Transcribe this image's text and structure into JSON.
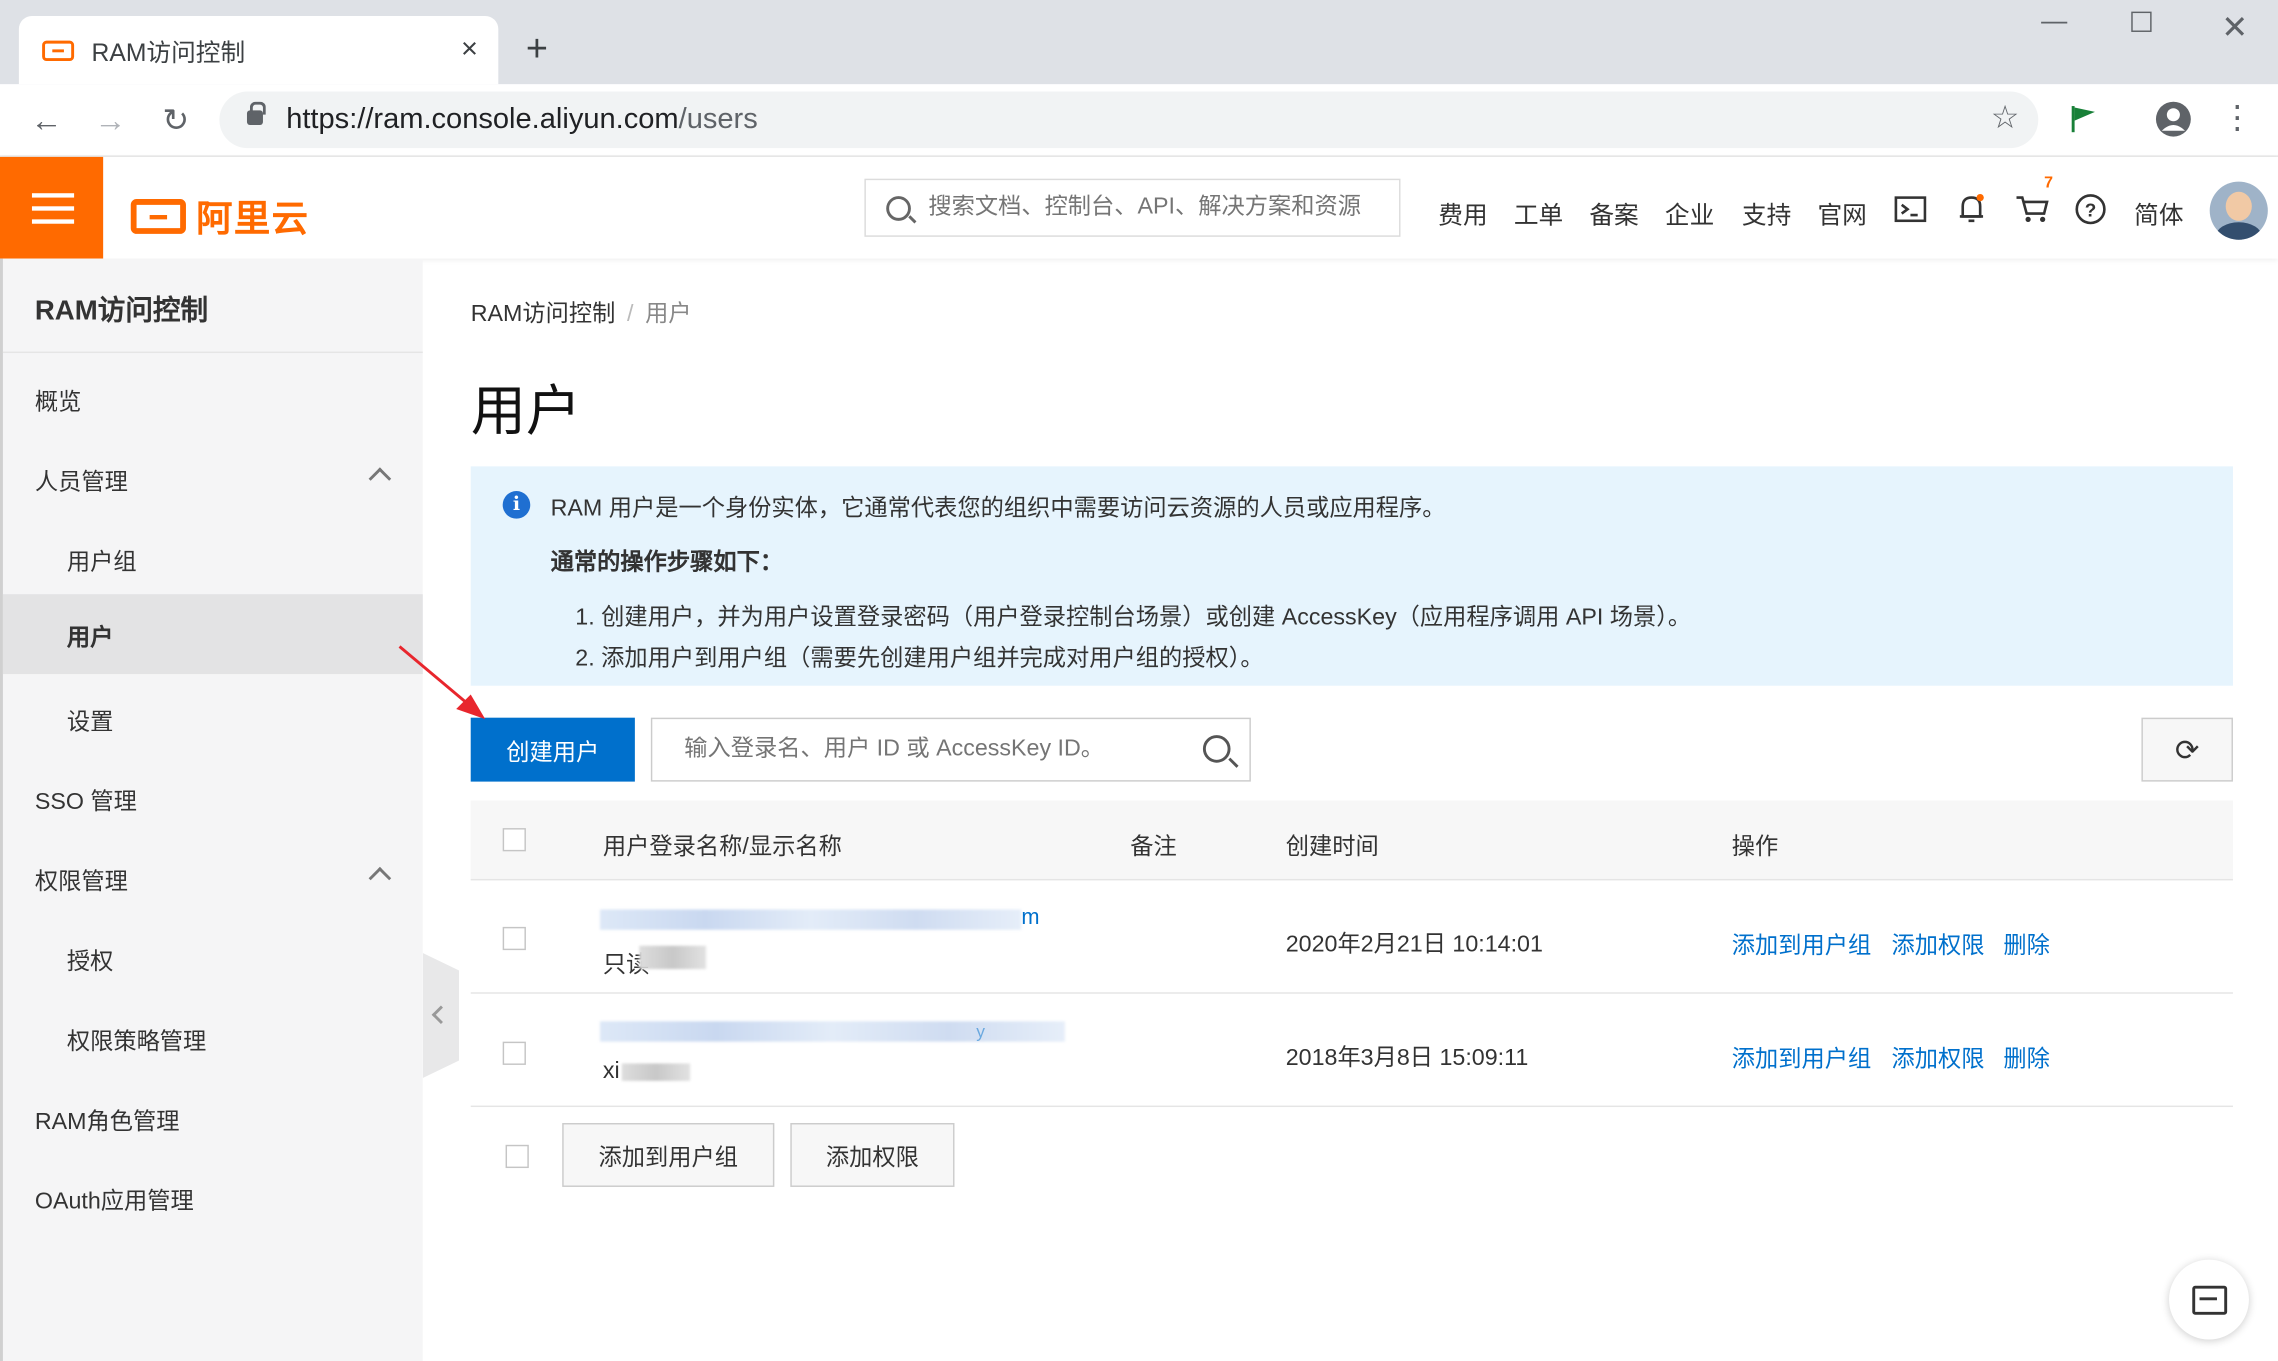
{
  "browser": {
    "tab_title": "RAM访问控制",
    "tab_close": "×",
    "new_tab": "+",
    "url_host": "https://ram.console.aliyun.com",
    "url_path": "/users"
  },
  "header": {
    "logo_text": "阿里云",
    "search_placeholder": "搜索文档、控制台、API、解决方案和资源",
    "links": [
      "费用",
      "工单",
      "备案",
      "企业",
      "支持",
      "官网"
    ],
    "cart_badge": "7",
    "lang": "简体",
    "brand_color": "#ff6a00"
  },
  "sidebar": {
    "title": "RAM访问控制",
    "items": [
      {
        "label": "概览"
      },
      {
        "label": "人员管理"
      },
      {
        "label": "用户组"
      },
      {
        "label": "用户"
      },
      {
        "label": "设置"
      },
      {
        "label": "SSO 管理"
      },
      {
        "label": "权限管理"
      },
      {
        "label": "授权"
      },
      {
        "label": "权限策略管理"
      },
      {
        "label": "RAM角色管理"
      },
      {
        "label": "OAuth应用管理"
      }
    ]
  },
  "breadcrumb": {
    "root": "RAM访问控制",
    "sep": "/",
    "current": "用户"
  },
  "page_title": "用户",
  "notice": {
    "line1": "RAM 用户是一个身份实体，它通常代表您的组织中需要访问云资源的人员或应用程序。",
    "heading": "通常的操作步骤如下：",
    "step1": "1. 创建用户，并为用户设置登录密码（用户登录控制台场景）或创建 AccessKey（应用程序调用 API 场景）。",
    "step2": "2. 添加用户到用户组（需要先创建用户组并完成对用户组的授权）。"
  },
  "toolbar": {
    "create_label": "创建用户",
    "search_placeholder": "输入登录名、用户 ID 或 AccessKey ID。"
  },
  "table": {
    "columns": [
      "用户登录名称/显示名称",
      "备注",
      "创建时间",
      "操作"
    ],
    "rows": [
      {
        "login_tail": "m",
        "display_prefix": "只读",
        "created": "2020年2月21日 10:14:01"
      },
      {
        "login_tail": "y",
        "display_prefix": "xi",
        "created": "2018年3月8日 15:09:11"
      }
    ],
    "actions": {
      "add_group": "添加到用户组",
      "add_perm": "添加权限",
      "delete": "删除"
    }
  },
  "footer_actions": {
    "add_group": "添加到用户组",
    "add_perm": "添加权限"
  }
}
